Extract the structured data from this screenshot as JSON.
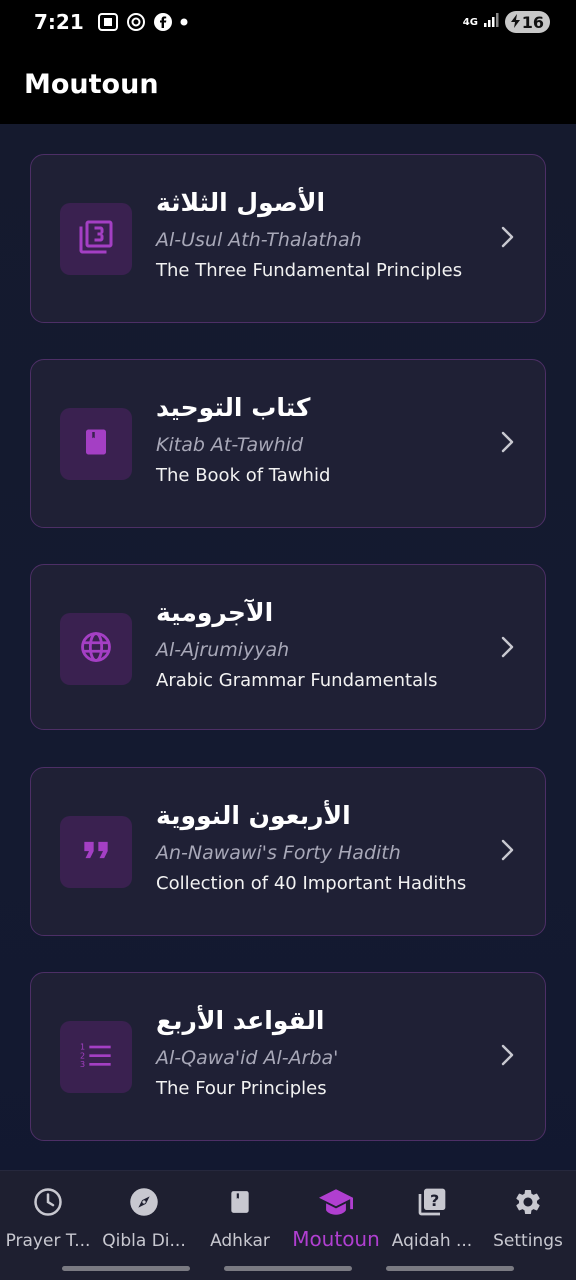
{
  "status": {
    "time": "7:21",
    "network": "4G",
    "battery": "16",
    "icons": [
      "screenshot-icon",
      "openai-icon",
      "facebook-icon",
      "dot-icon",
      "signal-icon",
      "charging-icon"
    ]
  },
  "app": {
    "title": "Moutoun"
  },
  "cards": [
    {
      "arabic": "الأصول الثلاثة",
      "translit": "Al-Usul Ath-Thalathah",
      "desc": "The Three Fundamental Principles",
      "icon": "filter-3-icon"
    },
    {
      "arabic": "كتاب التوحيد",
      "translit": "Kitab At-Tawhid",
      "desc": "The Book of Tawhid",
      "icon": "book-icon"
    },
    {
      "arabic": "الآجرومية",
      "translit": "Al-Ajrumiyyah",
      "desc": "Arabic Grammar Fundamentals",
      "icon": "globe-icon"
    },
    {
      "arabic": "الأربعون النووية",
      "translit": "An-Nawawi's Forty Hadith",
      "desc": "Collection of 40 Important Hadiths",
      "icon": "quote-icon"
    },
    {
      "arabic": "القواعد الأربع",
      "translit": "Al-Qawa'id Al-Arba'",
      "desc": "The Four Principles",
      "icon": "numbered-list-icon"
    }
  ],
  "nav": {
    "items": [
      {
        "label": "Prayer T...",
        "icon": "clock-icon"
      },
      {
        "label": "Qibla Di...",
        "icon": "compass-icon"
      },
      {
        "label": "Adhkar",
        "icon": "book-icon"
      },
      {
        "label": "Moutoun",
        "icon": "graduation-cap-icon",
        "active": true
      },
      {
        "label": "Aqidah ...",
        "icon": "question-book-icon"
      },
      {
        "label": "Settings",
        "icon": "gear-icon"
      }
    ]
  },
  "colors": {
    "accent": "#b03fd0",
    "icon_bg": "#3a2150",
    "card_bg": "#1f2035",
    "card_border": "#4d2f66",
    "background": "#151a2e"
  }
}
